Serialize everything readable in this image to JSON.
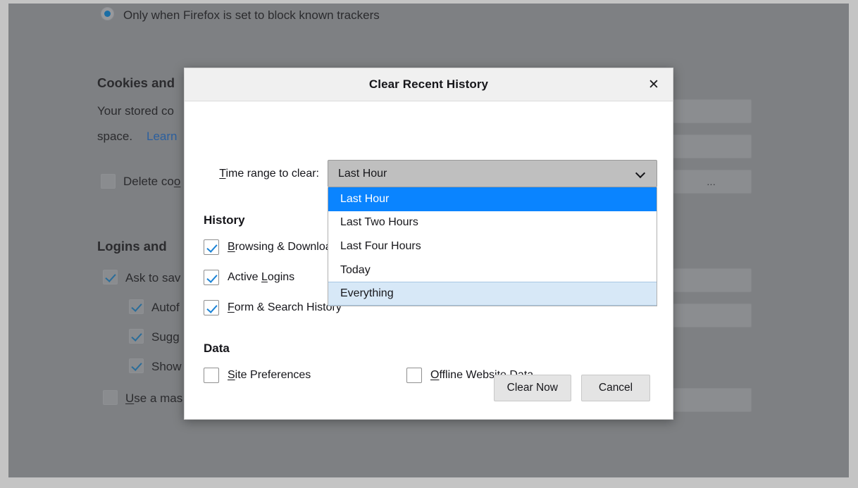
{
  "background": {
    "radio_option": {
      "label": "Only when Firefox is set to block known trackers",
      "selected": true
    },
    "cookies_section": {
      "heading": "Cookies and",
      "description_line1": "Your stored co",
      "description_line2_prefix": "space.",
      "description_link": "Learn",
      "checkbox_label_prefix": "Delete co",
      "checkbox_label_underlined": "o",
      "checkbox_checked": false
    },
    "logins_section": {
      "heading": "Logins and",
      "items": [
        {
          "label": "Ask to sav",
          "checked": true,
          "indent": false
        },
        {
          "label": "Autof",
          "checked": true,
          "indent": true
        },
        {
          "label": "Sugg",
          "checked": true,
          "indent": true,
          "underline": "u"
        },
        {
          "label": "Show",
          "checked": true,
          "indent": true
        },
        {
          "label": "se a mas",
          "underlined_first": "U",
          "checked": false,
          "indent": false
        }
      ]
    },
    "side_buttons": [
      {
        "label": ""
      },
      {
        "label": ""
      },
      {
        "label": "..."
      },
      {
        "label": ""
      },
      {
        "label": ""
      },
      {
        "label": ""
      }
    ]
  },
  "dialog": {
    "title": "Clear Recent History",
    "close_icon": "close-icon",
    "time_range": {
      "label_access_key": "T",
      "label_rest": "ime range to clear:",
      "selected_value": "Last Hour",
      "chevron_icon": "chevron-down-icon",
      "expanded": true,
      "options": [
        {
          "label": "Last Hour",
          "state": "selected"
        },
        {
          "label": "Last Two Hours",
          "state": "normal"
        },
        {
          "label": "Last Four Hours",
          "state": "normal"
        },
        {
          "label": "Today",
          "state": "normal"
        },
        {
          "label": "Everything",
          "state": "hover"
        }
      ]
    },
    "history_section": {
      "title": "History",
      "items": [
        {
          "access_key": "B",
          "label_rest": "rowsing & Download History",
          "checked": true
        },
        {
          "label_pre": "Active ",
          "access_key": "L",
          "label_rest": "ogins",
          "checked": true
        },
        {
          "access_key": "F",
          "label_rest": "orm & Search History",
          "checked": true
        }
      ]
    },
    "data_section": {
      "title": "Data",
      "items": [
        {
          "access_key": "S",
          "label_rest": "ite Preferences",
          "checked": false
        },
        {
          "access_key": "O",
          "label_rest": "ffline Website Data",
          "checked": false
        }
      ]
    },
    "buttons": {
      "primary": "Clear Now",
      "secondary": "Cancel"
    }
  },
  "colors": {
    "accent_blue": "#0a84ff",
    "hover_blue": "#d7e8f7",
    "overlay_gray": "#7e8083",
    "dialog_header": "#f0f0f0",
    "checkbox_check": "#1b83d6"
  }
}
